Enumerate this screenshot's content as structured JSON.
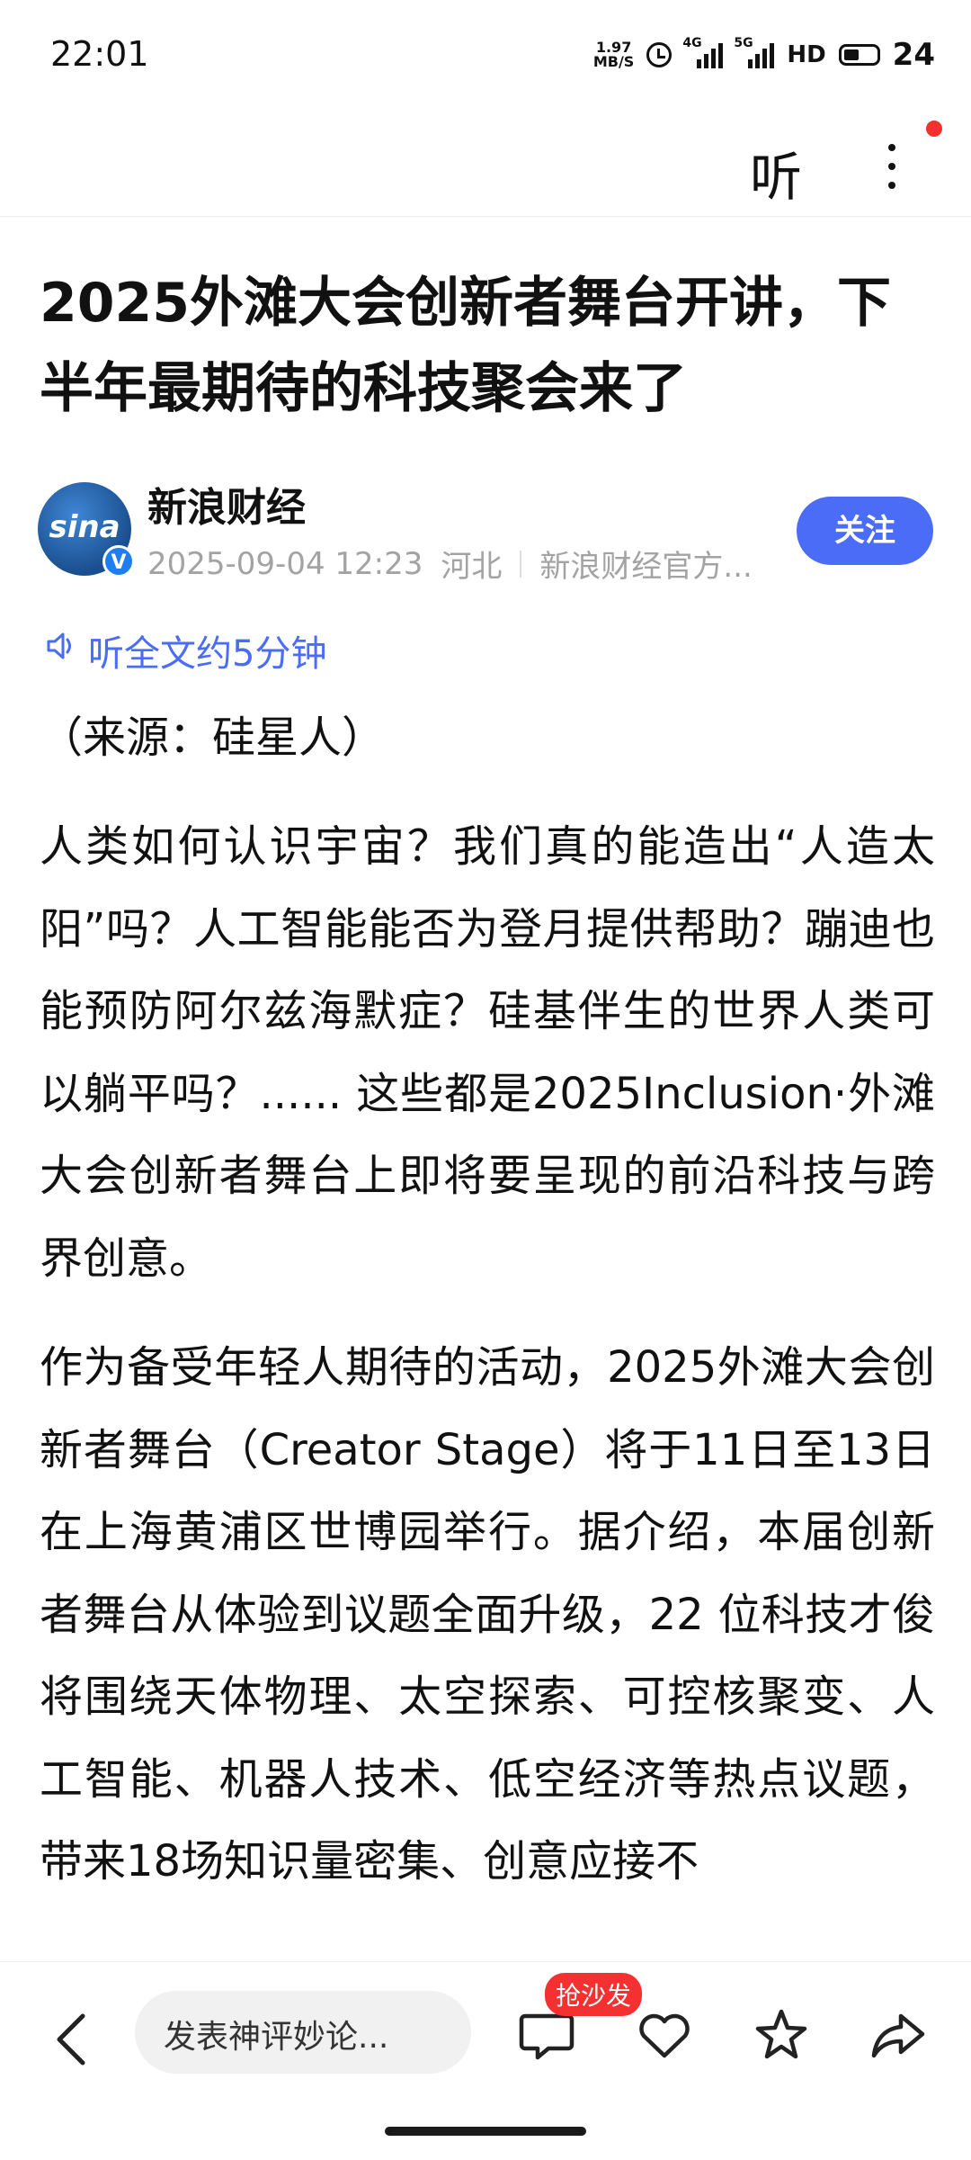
{
  "status_bar": {
    "time": "22:01",
    "net_speed_value": "1.97",
    "net_speed_unit": "MB/S",
    "signal1_label": "4G",
    "signal2_label": "5G",
    "hd_label": "HD",
    "battery": "24"
  },
  "top_bar": {
    "listen_label": "听",
    "notification_dot_color": "#f43030"
  },
  "article": {
    "title": "2025外滩大会创新者舞台开讲，下半年最期待的科技聚会来了",
    "author": {
      "name": "新浪财经",
      "avatar_logo": "sina",
      "verified_mark": "V",
      "date": "2025-09-04 12:23",
      "location": "河北",
      "account": "新浪财经官方..."
    },
    "follow_label": "关注",
    "listen_full_label": "听全文约5分钟",
    "source": "（来源：硅星人）",
    "paragraphs": [
      "人类如何认识宇宙？我们真的能造出“人造太阳”吗？人工智能能否为登月提供帮助？蹦迪也能预防阿尔兹海默症？硅基伴生的世界人类可以躺平吗？...... 这些都是2025Inclusion·外滩大会创新者舞台上即将要呈现的前沿科技与跨界创意。",
      "作为备受年轻人期待的活动，2025外滩大会创新者舞台（Creator Stage）将于11日至13日在上海黄浦区世博园举行。据介绍，本届创新者舞台从体验到议题全面升级，22 位科技才俊将围绕天体物理、太空探索、可控核聚变、人工智能、机器人技术、低空经济等热点议题，带来18场知识量密集、创意应接不"
    ]
  },
  "bottom_bar": {
    "comment_placeholder": "发表神评妙论...",
    "badge_label": "抢沙发",
    "accent_color": "#4a6cf7"
  }
}
